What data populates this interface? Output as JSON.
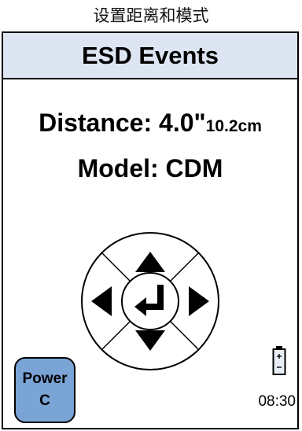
{
  "caption": "设置距离和模式",
  "header": {
    "title": "ESD Events"
  },
  "distance": {
    "label": "Distance: 4.0\"",
    "metric": "10.2cm"
  },
  "model": {
    "label": "Model: CDM"
  },
  "dpad": {
    "up_icon": "triangle-up",
    "down_icon": "triangle-down",
    "left_icon": "triangle-left",
    "right_icon": "triangle-right",
    "enter_icon": "enter-return-arrow"
  },
  "power_button": {
    "line1": "Power",
    "line2": "C",
    "color": "#7aa3d6"
  },
  "status": {
    "time": "08:30",
    "battery_icon": "battery-icon"
  },
  "colors": {
    "header_bg": "#dde5f2",
    "frame": "#000000"
  }
}
